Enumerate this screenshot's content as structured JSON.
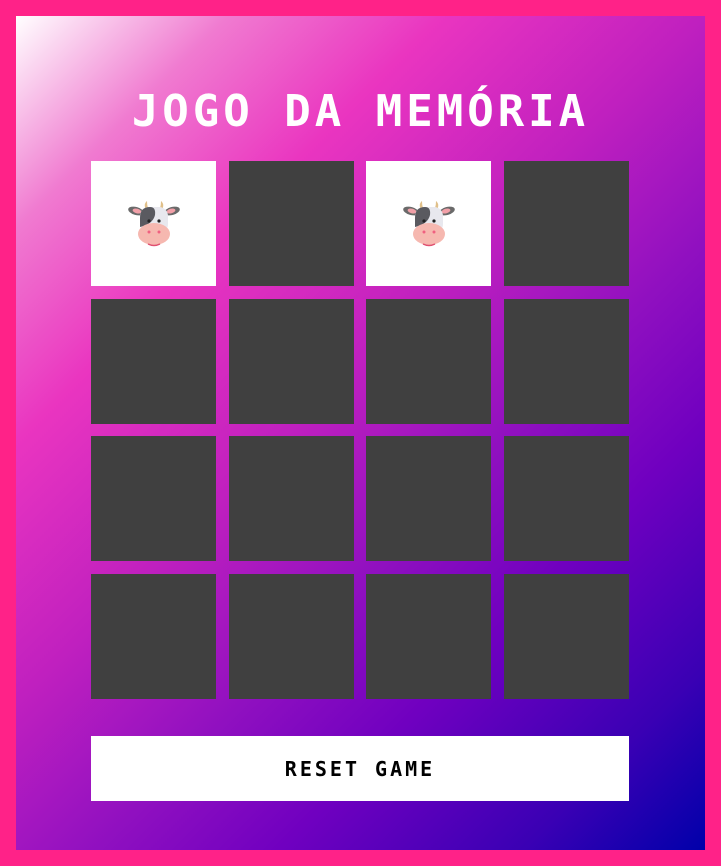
{
  "title": "JOGO DA MEMÓRIA",
  "cards": [
    {
      "state": "open",
      "icon": "cow-face"
    },
    {
      "state": "closed"
    },
    {
      "state": "open",
      "icon": "cow-face"
    },
    {
      "state": "closed"
    },
    {
      "state": "closed"
    },
    {
      "state": "closed"
    },
    {
      "state": "closed"
    },
    {
      "state": "closed"
    },
    {
      "state": "closed"
    },
    {
      "state": "closed"
    },
    {
      "state": "closed"
    },
    {
      "state": "closed"
    },
    {
      "state": "closed"
    },
    {
      "state": "closed"
    },
    {
      "state": "closed"
    },
    {
      "state": "closed"
    }
  ],
  "reset_label": "RESET GAME",
  "colors": {
    "frame": "#ff2288",
    "card_back": "#404040",
    "card_face": "#ffffff"
  }
}
